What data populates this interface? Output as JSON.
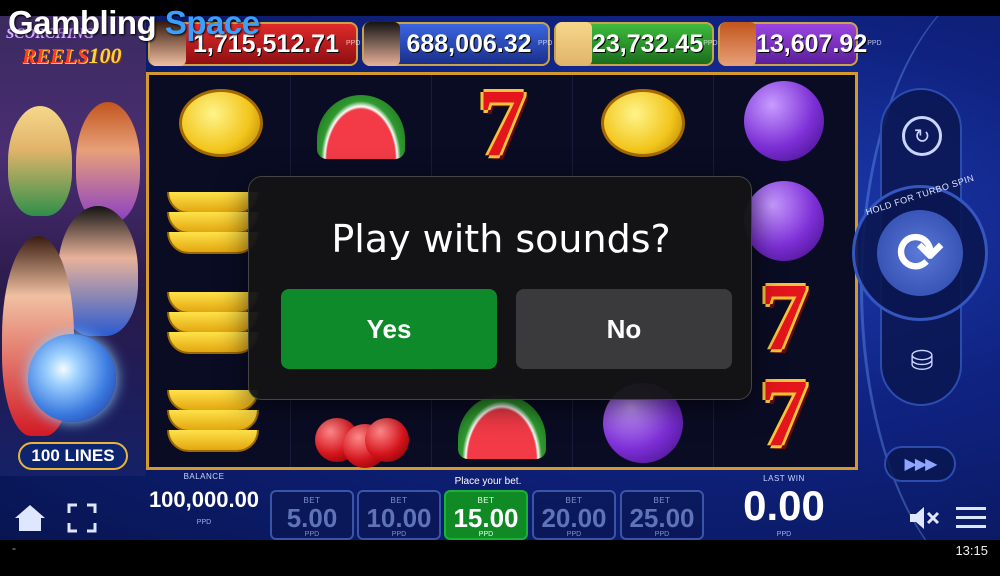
{
  "watermark": {
    "part1": "Gambling",
    "part2": "Space"
  },
  "game": {
    "logo_word1": "SCORCHING",
    "logo_word2": "REELS",
    "logo_number": "100",
    "lines_badge": "100 LINES"
  },
  "jackpots": [
    {
      "value": "1,715,512.71",
      "unit": "PPD",
      "color": "#c0181c"
    },
    {
      "value": "688,006.32",
      "unit": "PPD",
      "color": "#2a4bc0"
    },
    {
      "value": "23,732.45",
      "unit": "PPD",
      "color": "#2a9a2a"
    },
    {
      "value": "13,607.92",
      "unit": "PPD",
      "color": "#7d2fc8"
    }
  ],
  "reels": [
    [
      "lemon",
      "banana",
      "banana",
      "banana"
    ],
    [
      "watermelon",
      "hidden",
      "hidden",
      "cherry"
    ],
    [
      "seven",
      "hidden",
      "hidden",
      "watermelon"
    ],
    [
      "lemon",
      "hidden",
      "hidden",
      "plum"
    ],
    [
      "plum",
      "plum",
      "seven",
      "seven"
    ]
  ],
  "controls": {
    "turbo_hint": "HOLD FOR TURBO SPIN",
    "replay_icon": "replay-icon",
    "spin_icon": "spin-icon",
    "coins_icon": "coins-icon",
    "autoplay_icon": "fast-forward-icon"
  },
  "bottom": {
    "balance_label": "BALANCE",
    "balance_value": "100,000.00",
    "balance_unit": "PPD",
    "place_bet": "Place your bet.",
    "bet_label": "BET",
    "bet_unit": "PPD",
    "bets": [
      "5.00",
      "10.00",
      "15.00",
      "20.00",
      "25.00"
    ],
    "selected_bet": "15.00",
    "lastwin_label": "LAST WIN",
    "lastwin_value": "0.00",
    "lastwin_unit": "PPD"
  },
  "dialog": {
    "title": "Play with sounds?",
    "yes_label": "Yes",
    "no_label": "No"
  },
  "system": {
    "clock": "13:15",
    "left_mark": "-"
  },
  "colors": {
    "accent_green": "#0e8a2a",
    "reel_frame": "#d49a2c",
    "stage_blue": "#0f2280"
  }
}
